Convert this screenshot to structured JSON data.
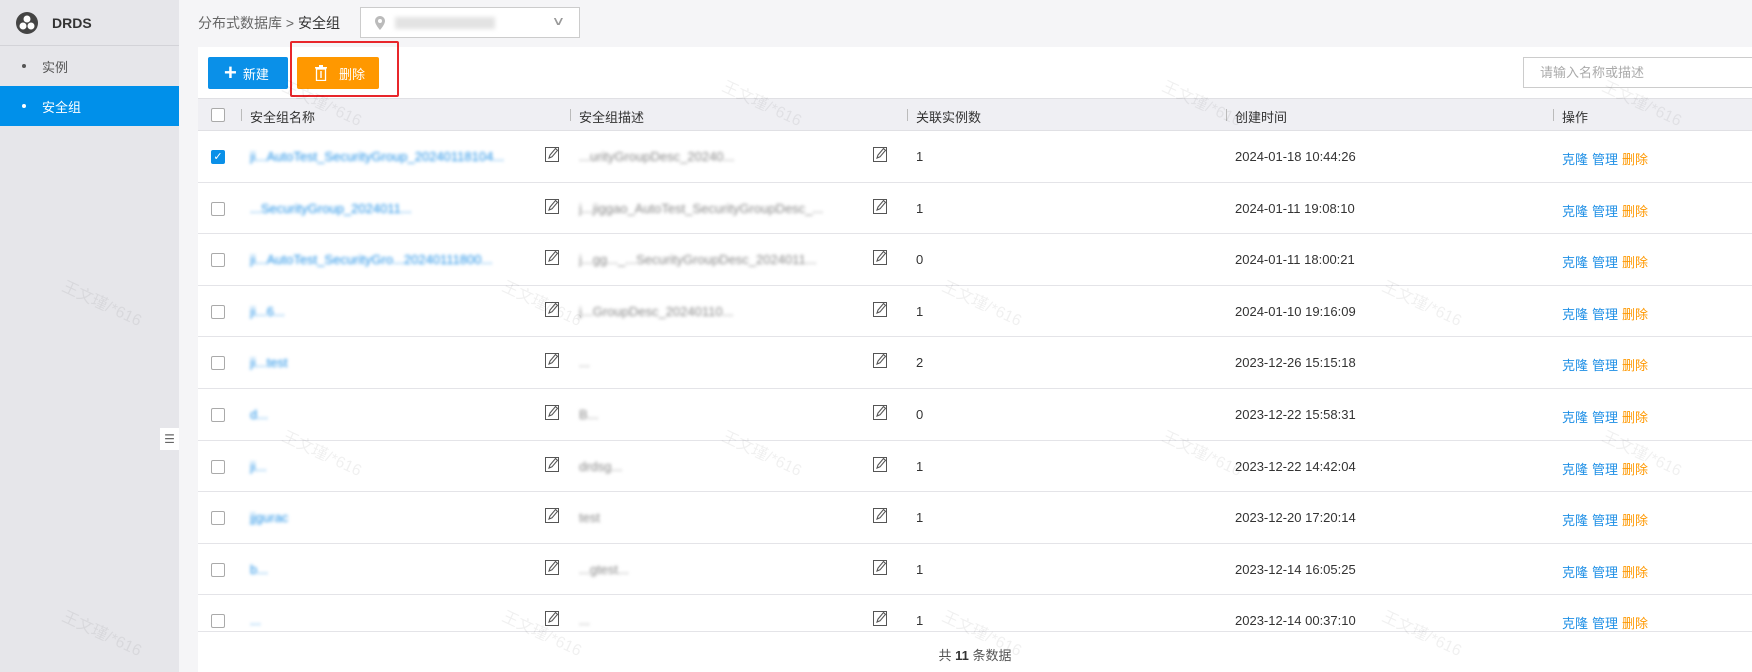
{
  "app": {
    "title": "DRDS"
  },
  "sidebar": {
    "items": [
      {
        "label": "实例"
      },
      {
        "label": "安全组"
      }
    ]
  },
  "breadcrumb": {
    "parent": "分布式数据库",
    "separator": ">",
    "current": "安全组"
  },
  "toolbar": {
    "new_label": "新建",
    "delete_label": "删除",
    "search_placeholder": "请输入名称或描述"
  },
  "table": {
    "headers": [
      "安全组名称",
      "安全组描述",
      "关联实例数",
      "创建时间",
      "操作"
    ],
    "rows": [
      {
        "checked": true,
        "name": "ji...AutoTest_SecurityGroup_20240118104...",
        "desc": "...urityGroupDesc_20240...",
        "count": "1",
        "time": "2024-01-18 10:44:26"
      },
      {
        "checked": false,
        "name": "...SecurityGroup_2024011...",
        "desc": "j...jiggao_AutoTest_SecurityGroupDesc_...",
        "count": "1",
        "time": "2024-01-11 19:08:10"
      },
      {
        "checked": false,
        "name": "ji...AutoTest_SecurityGro...20240111800...",
        "desc": "j...gg..._...SecurityGroupDesc_2024011...",
        "count": "0",
        "time": "2024-01-11 18:00:21"
      },
      {
        "checked": false,
        "name": "ji...6...",
        "desc": "j...GroupDesc_20240110...",
        "count": "1",
        "time": "2024-01-10 19:16:09"
      },
      {
        "checked": false,
        "name": "ji...test",
        "desc": "...",
        "count": "2",
        "time": "2023-12-26 15:15:18"
      },
      {
        "checked": false,
        "name": "d...",
        "desc": "B...",
        "count": "0",
        "time": "2023-12-22 15:58:31"
      },
      {
        "checked": false,
        "name": "ji...",
        "desc": "drdsg...",
        "count": "1",
        "time": "2023-12-22 14:42:04"
      },
      {
        "checked": false,
        "name": "jjgurac",
        "desc": "test",
        "count": "1",
        "time": "2023-12-20 17:20:14"
      },
      {
        "checked": false,
        "name": "b...",
        "desc": "...gtest...",
        "count": "1",
        "time": "2023-12-14 16:05:25"
      },
      {
        "checked": false,
        "name": "...",
        "desc": "...",
        "count": "1",
        "time": "2023-12-14 00:37:10"
      }
    ],
    "actions": {
      "clone": "克隆",
      "manage": "管理",
      "delete": "删除"
    }
  },
  "footer": {
    "prefix": "共",
    "total": "11",
    "suffix": "条数据"
  },
  "watermark": "王文瑾/*616",
  "colors": {
    "primary": "#0a90e8",
    "warning": "#ff9800",
    "highlight": "#e8262b"
  }
}
